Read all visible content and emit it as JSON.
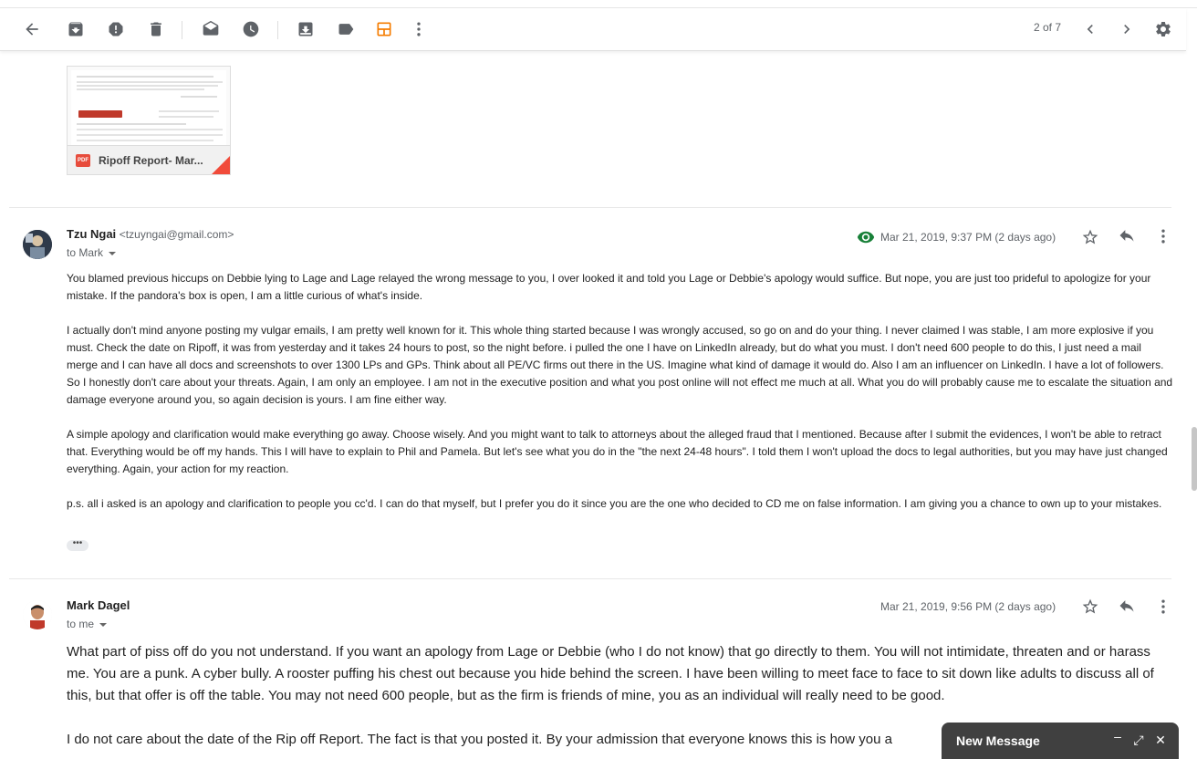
{
  "toolbar": {
    "pager": "2 of 7"
  },
  "attachment": {
    "type_label": "PDF",
    "name": "Ripoff Report- Mar..."
  },
  "messages": [
    {
      "sender_name": "Tzu Ngai",
      "sender_email": "<tzuyngai@gmail.com>",
      "to": "to Mark",
      "date": "Mar 21, 2019, 9:37 PM (2 days ago)",
      "paragraphs": [
        "You blamed previous hiccups on Debbie lying to Lage and Lage relayed the wrong message to you, I over looked it and told you Lage or Debbie's apology would suffice. But nope, you are just too prideful to apologize for your mistake. If the pandora's box is open, I am a little curious of what's inside.",
        "I actually don't mind anyone posting my vulgar emails, I am pretty well known for it. This whole thing started because I was wrongly accused, so go on and do your thing. I never claimed I was stable, I am more explosive if you must. Check the date on Ripoff, it was from yesterday and it takes 24 hours to post, so the night before. i pulled the one I have on LinkedIn already, but do what you must. I don't need 600 people to do this, I just need a mail merge and I can have all docs and screenshots to over 1300 LPs and GPs. Think about all PE/VC firms out there in the US. Imagine what kind of damage it would do. Also I am an influencer on LinkedIn. I have a lot of followers. So I honestly don't care about your threats. Again, I am only an employee. I am not in the executive position and what you post online will not effect me much at all. What you do will probably cause me to escalate the situation and damage everyone around you, so again decision is yours. I am fine either way.",
        "A simple apology and clarification would make everything go away. Choose wisely. And you might want to talk to attorneys about the alleged fraud that I mentioned. Because after I submit the evidences, I won't be able to retract that. Everything would be off my hands. This I will have to explain to Phil and Pamela. But let's see what you do in the \"the next 24-48 hours\". I told them I won't upload the docs to legal authorities, but you may have just changed everything. Again, your action for my reaction.",
        "p.s. all i asked is an apology and clarification to people you cc'd. I can do that myself, but I prefer you do it since you are the one who decided to CD me on false information. I am giving you a chance to own up to your mistakes."
      ],
      "more_label": "•••"
    },
    {
      "sender_name": "Mark Dagel",
      "to": "to me",
      "date": "Mar 21, 2019, 9:56 PM (2 days ago)",
      "paragraphs": [
        "What part of piss off do you not understand. If you want an apology from Lage or Debbie (who I do not know) that go directly to them. You will not intimidate, threaten and or harass me. You are a punk. A cyber bully. A rooster puffing his chest out because you hide behind the screen. I have been willing to meet face to face to sit down like adults to discuss all of this, but that offer is off the table. You may not need 600 people, but as the firm is friends of mine, you as an individual will really need to be good.",
        "I do not care about the date of the Rip off Report. The fact is that you posted it. By your admission that everyone knows this is how you a"
      ]
    }
  ],
  "compose": {
    "title": "New Message",
    "minimize": "‒",
    "expand": "⤢",
    "close": "✕"
  },
  "colors": {
    "layout_icon": "#f57c00",
    "seen_icon": "#188038",
    "pdf_red": "#e74c3c"
  }
}
